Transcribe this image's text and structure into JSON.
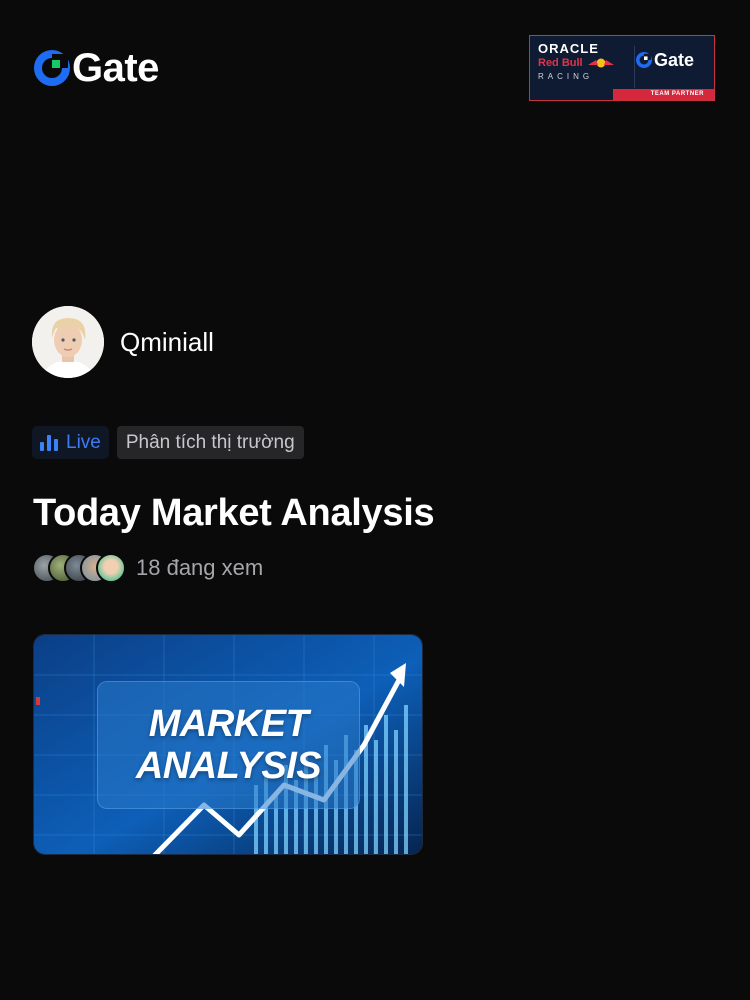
{
  "header": {
    "brand_name": "Gate",
    "brand_color": "#1d6cf2",
    "brand_accent": "#17c964",
    "partner": {
      "oracle": "ORACLE",
      "redbull": "Red Bull",
      "racing": "RACING",
      "gate": "Gate",
      "badge": "TEAM PARTNER"
    }
  },
  "host": {
    "name": "Qminiall",
    "avatar_icon": "avatar"
  },
  "tags": {
    "live_label": "Live",
    "category": "Phân tích thị trường",
    "live_color": "#3d7cf4"
  },
  "stream": {
    "title": "Today Market Analysis",
    "viewers_text": "18 đang xem",
    "thumbnail": {
      "line1": "MARKET",
      "line2": "ANALYSIS"
    }
  }
}
